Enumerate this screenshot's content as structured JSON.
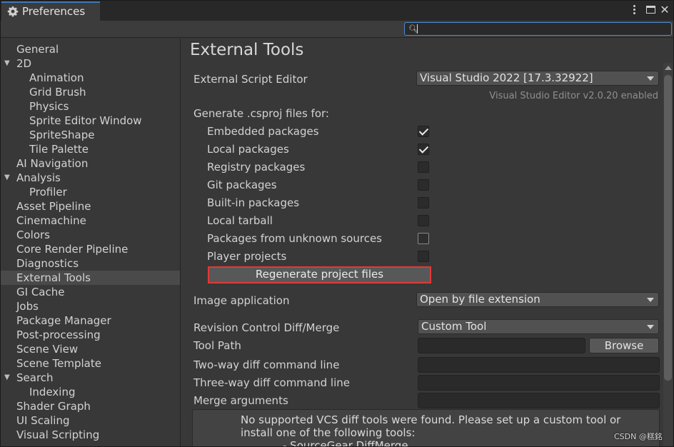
{
  "window": {
    "tab_title": "Preferences",
    "tab_icon": "gear-icon",
    "menu_icon": "kebab-menu-icon",
    "maximize_icon": "maximize-icon",
    "close_glyph": "✕"
  },
  "search": {
    "value": "",
    "placeholder": ""
  },
  "sidebar": {
    "items": [
      {
        "label": "General",
        "indent": 0,
        "expand": ""
      },
      {
        "label": "2D",
        "indent": 0,
        "expand": "▼"
      },
      {
        "label": "Animation",
        "indent": 1,
        "expand": ""
      },
      {
        "label": "Grid Brush",
        "indent": 1,
        "expand": ""
      },
      {
        "label": "Physics",
        "indent": 1,
        "expand": ""
      },
      {
        "label": "Sprite Editor Window",
        "indent": 1,
        "expand": ""
      },
      {
        "label": "SpriteShape",
        "indent": 1,
        "expand": ""
      },
      {
        "label": "Tile Palette",
        "indent": 1,
        "expand": ""
      },
      {
        "label": "AI Navigation",
        "indent": 0,
        "expand": ""
      },
      {
        "label": "Analysis",
        "indent": 0,
        "expand": "▼"
      },
      {
        "label": "Profiler",
        "indent": 1,
        "expand": ""
      },
      {
        "label": "Asset Pipeline",
        "indent": 0,
        "expand": ""
      },
      {
        "label": "Cinemachine",
        "indent": 0,
        "expand": ""
      },
      {
        "label": "Colors",
        "indent": 0,
        "expand": ""
      },
      {
        "label": "Core Render Pipeline",
        "indent": 0,
        "expand": ""
      },
      {
        "label": "Diagnostics",
        "indent": 0,
        "expand": ""
      },
      {
        "label": "External Tools",
        "indent": 0,
        "expand": "",
        "selected": true
      },
      {
        "label": "GI Cache",
        "indent": 0,
        "expand": ""
      },
      {
        "label": "Jobs",
        "indent": 0,
        "expand": ""
      },
      {
        "label": "Package Manager",
        "indent": 0,
        "expand": ""
      },
      {
        "label": "Post-processing",
        "indent": 0,
        "expand": ""
      },
      {
        "label": "Scene View",
        "indent": 0,
        "expand": ""
      },
      {
        "label": "Scene Template",
        "indent": 0,
        "expand": ""
      },
      {
        "label": "Search",
        "indent": 0,
        "expand": "▼"
      },
      {
        "label": "Indexing",
        "indent": 1,
        "expand": ""
      },
      {
        "label": "Shader Graph",
        "indent": 0,
        "expand": ""
      },
      {
        "label": "UI Scaling",
        "indent": 0,
        "expand": ""
      },
      {
        "label": "Visual Scripting",
        "indent": 0,
        "expand": ""
      }
    ]
  },
  "main": {
    "title": "External Tools",
    "script_editor": {
      "label": "External Script Editor",
      "value": "Visual Studio 2022 [17.3.32922]",
      "note": "Visual Studio Editor v2.0.20 enabled"
    },
    "generate_label": "Generate .csproj files for:",
    "packages": [
      {
        "label": "Embedded packages",
        "checked": true
      },
      {
        "label": "Local packages",
        "checked": true
      },
      {
        "label": "Registry packages",
        "checked": false
      },
      {
        "label": "Git packages",
        "checked": false
      },
      {
        "label": "Built-in packages",
        "checked": false
      },
      {
        "label": "Local tarball",
        "checked": false
      },
      {
        "label": "Packages from unknown sources",
        "checked": false
      },
      {
        "label": "Player projects",
        "checked": false
      }
    ],
    "regenerate_label": "Regenerate project files",
    "image_application": {
      "label": "Image application",
      "value": "Open by file extension"
    },
    "revision_control": {
      "label": "Revision Control Diff/Merge",
      "value": "Custom Tool"
    },
    "tool_path": {
      "label": "Tool Path",
      "value": "",
      "browse_label": "Browse"
    },
    "two_way": {
      "label": "Two-way diff command line",
      "value": ""
    },
    "three_way": {
      "label": "Three-way diff command line",
      "value": ""
    },
    "merge_args": {
      "label": "Merge arguments",
      "value": ""
    },
    "help": {
      "text": "No supported VCS diff tools were found. Please set up a custom tool or install one of the following tools:",
      "item": "- SourceGear DiffMerge"
    }
  },
  "watermark": "CSDN @糕銘",
  "colors": {
    "accent": "#3a79bb",
    "highlight_border": "#e03a3a",
    "background": "#383838"
  }
}
